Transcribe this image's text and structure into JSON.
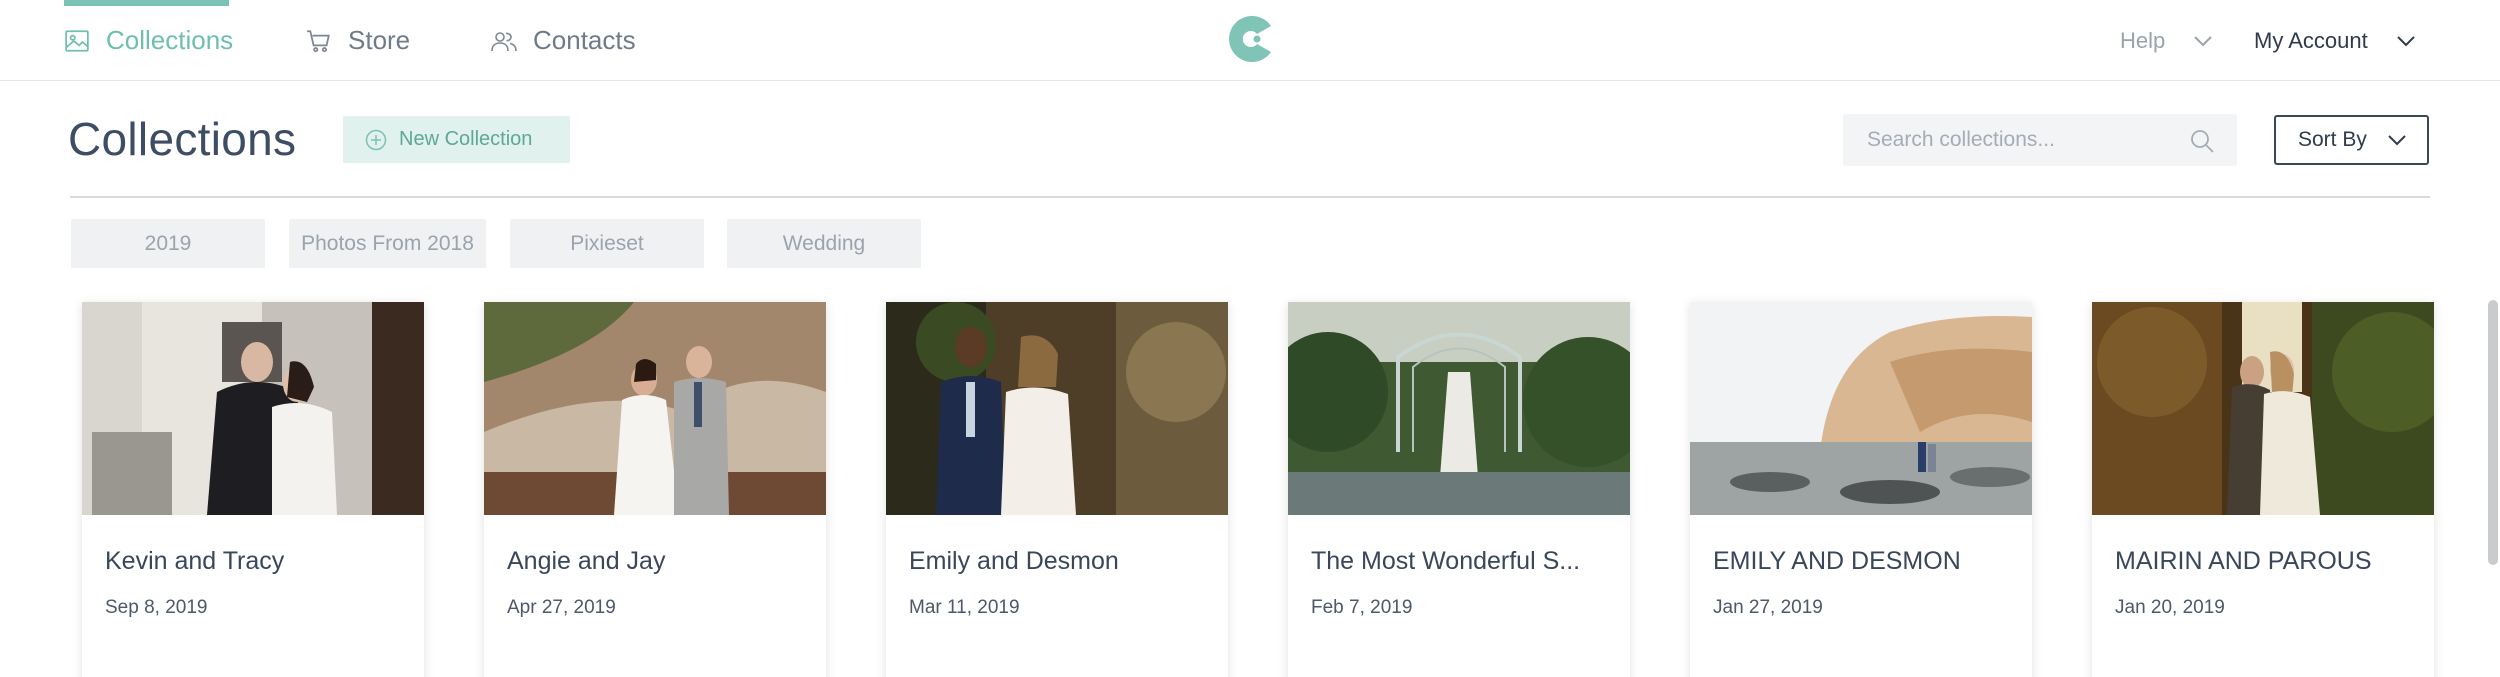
{
  "nav": {
    "items": [
      {
        "label": "Collections",
        "icon": "image-icon"
      },
      {
        "label": "Store",
        "icon": "cart-icon"
      },
      {
        "label": "Contacts",
        "icon": "people-icon"
      }
    ],
    "help_label": "Help",
    "account_label": "My Account"
  },
  "header": {
    "title": "Collections",
    "new_collection_label": "New Collection",
    "search_placeholder": "Search collections...",
    "sort_label": "Sort By"
  },
  "tags": [
    "2019",
    "Photos From 2018",
    "Pixieset",
    "Wedding"
  ],
  "collections": [
    {
      "title": "Kevin and Tracy",
      "date": "Sep 8, 2019"
    },
    {
      "title": "Angie and Jay",
      "date": "Apr 27, 2019"
    },
    {
      "title": "Emily and Desmon",
      "date": "Mar 11, 2019"
    },
    {
      "title": "The Most Wonderful S...",
      "date": "Feb 7, 2019"
    },
    {
      "title": "EMILY AND DESMON",
      "date": "Jan 27, 2019"
    },
    {
      "title": "MAIRIN AND PAROUS",
      "date": "Jan 20, 2019"
    }
  ],
  "colors": {
    "accent": "#79c3b4",
    "accent_light": "#e1f1ed",
    "text_dark": "#3d4d63",
    "tag_bg": "#f0f1f3"
  }
}
